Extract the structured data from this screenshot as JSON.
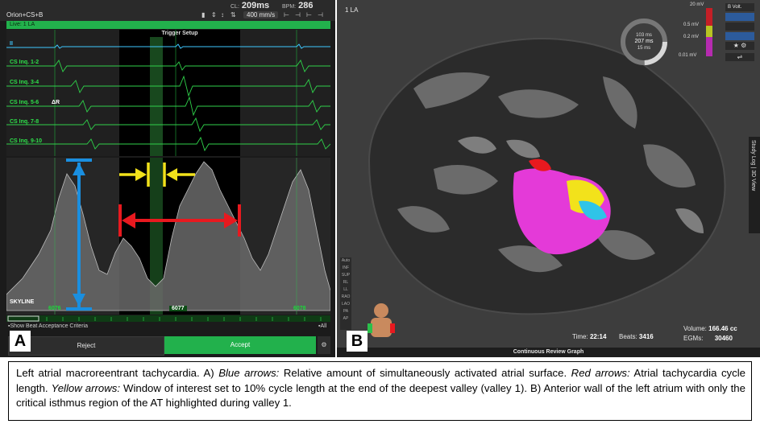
{
  "panel_a": {
    "letter": "A",
    "channel_selector": "Orion+CS+B",
    "cl_label": "CL:",
    "cl_value": "209ms",
    "bpm_label": "BPM:",
    "bpm_value": "286",
    "sweep_speed": "400 mm/s",
    "live_label": "Live: 1 LA",
    "trigger_title": "Trigger Setup",
    "channels": [
      "II",
      "CS Inq. 1-2",
      "CS Inq. 3-4",
      "CS Inq. 5-6",
      "CS Inq. 7-8",
      "CS Inq. 9-10"
    ],
    "ar_marker": "ΔR",
    "skyline_label": "SKYLINE",
    "beats": [
      "6076",
      "6077",
      "6078"
    ],
    "selected_beat": "6077",
    "criteria_label": "Show Beat Acceptance Criteria",
    "all_label": "All",
    "reject_label": "Reject",
    "accept_label": "Accept"
  },
  "panel_b": {
    "letter": "B",
    "map_title": "1 LA",
    "ring_values": [
      "103 ms",
      "207 ms",
      "15 ms"
    ],
    "voltage_top": "20 mV",
    "voltage_mid_high": "0.5 mV",
    "voltage_mid_low": "0.2 mV",
    "voltage_bottom": "0.01 mV",
    "voltage_mode": "B Volt.",
    "side_tab": "Study Log | 3D View",
    "left_tools": [
      "Auto",
      "INF",
      "SUP",
      "RL",
      "LL",
      "RAO",
      "LAO",
      "PA",
      "AP"
    ],
    "time_label": "Time:",
    "time_value": "22:14",
    "beats_label": "Beats:",
    "beats_value": "3416",
    "volume_label": "Volume:",
    "volume_value": "166.46 cc",
    "egms_label": "EGMs:",
    "egms_value": "30460",
    "bottom_bar": "Continuous Review Graph"
  },
  "caption": {
    "title": "Left atrial macroreentrant tachycardia.",
    "a_label": "A)",
    "blue_label": "Blue arrows:",
    "blue_text": "Relative amount of simultaneously activated atrial surface.",
    "red_label": "Red arrows:",
    "red_text": "Atrial tachycardia cycle length.",
    "yellow_label": "Yellow arrows:",
    "yellow_text": "Window of interest set to 10% cycle length at the end of the deepest valley (valley 1).",
    "b_label": "B)",
    "b_text": "Anterior wall of the left atrium with only the critical isthmus region of the AT highlighted during valley 1."
  },
  "colors": {
    "accent_green": "#22b14c",
    "blue_arrow": "#1a8fe0",
    "red_arrow": "#e8191f",
    "yellow_arrow": "#f2e21b"
  }
}
